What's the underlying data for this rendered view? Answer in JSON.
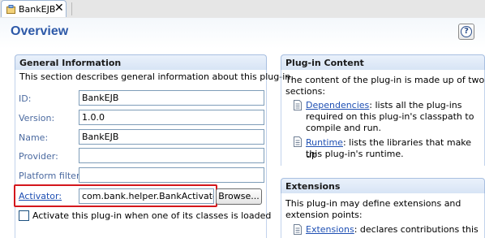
{
  "tab": {
    "label": "BankEJB",
    "close_glyph": "✕",
    "icon": "plugin-icon"
  },
  "header": {
    "title": "Overview",
    "help_glyph": "?",
    "help_icon": "help-icon"
  },
  "general_info": {
    "title": "General Information",
    "description": "This section describes general information about this plug-in.",
    "fields": {
      "id": {
        "label": "ID:",
        "value": "BankEJB"
      },
      "version": {
        "label": "Version:",
        "value": "1.0.0"
      },
      "name": {
        "label": "Name:",
        "value": "BankEJB"
      },
      "provider": {
        "label": "Provider:",
        "value": ""
      },
      "platform_filter": {
        "label": "Platform filter:",
        "value": ""
      },
      "activator": {
        "label": "Activator:",
        "value": "com.bank.helper.BankActivator"
      }
    },
    "browse_label": "Browse...",
    "activate_checkbox": {
      "label": "Activate this plug-in when one of its classes is loaded",
      "checked": false
    }
  },
  "plugin_content": {
    "title": "Plug-in Content",
    "intro_line1": "The content of the plug-in is made up of two",
    "intro_line2": "sections:",
    "items": [
      {
        "link": "Dependencies",
        "text1": ": lists all the plug-ins",
        "text2": "required on this plug-in's classpath to",
        "text3": "compile and run.",
        "icon": "page-icon"
      },
      {
        "link": "Runtime",
        "text1": ": lists the libraries that make up",
        "text2": "this plug-in's runtime.",
        "icon": "page-icon"
      }
    ]
  },
  "extensions": {
    "title": "Extensions",
    "intro_line1": "This plug-in may define extensions and",
    "intro_line2": "extension points:",
    "items": [
      {
        "link": "Extensions",
        "text1": ": declares contributions this",
        "icon": "page-icon"
      }
    ]
  },
  "colors": {
    "title": "#2d59a8",
    "link": "#1e4fb3",
    "highlight_box": "#d4171c",
    "section_border": "#a8bfe0"
  }
}
